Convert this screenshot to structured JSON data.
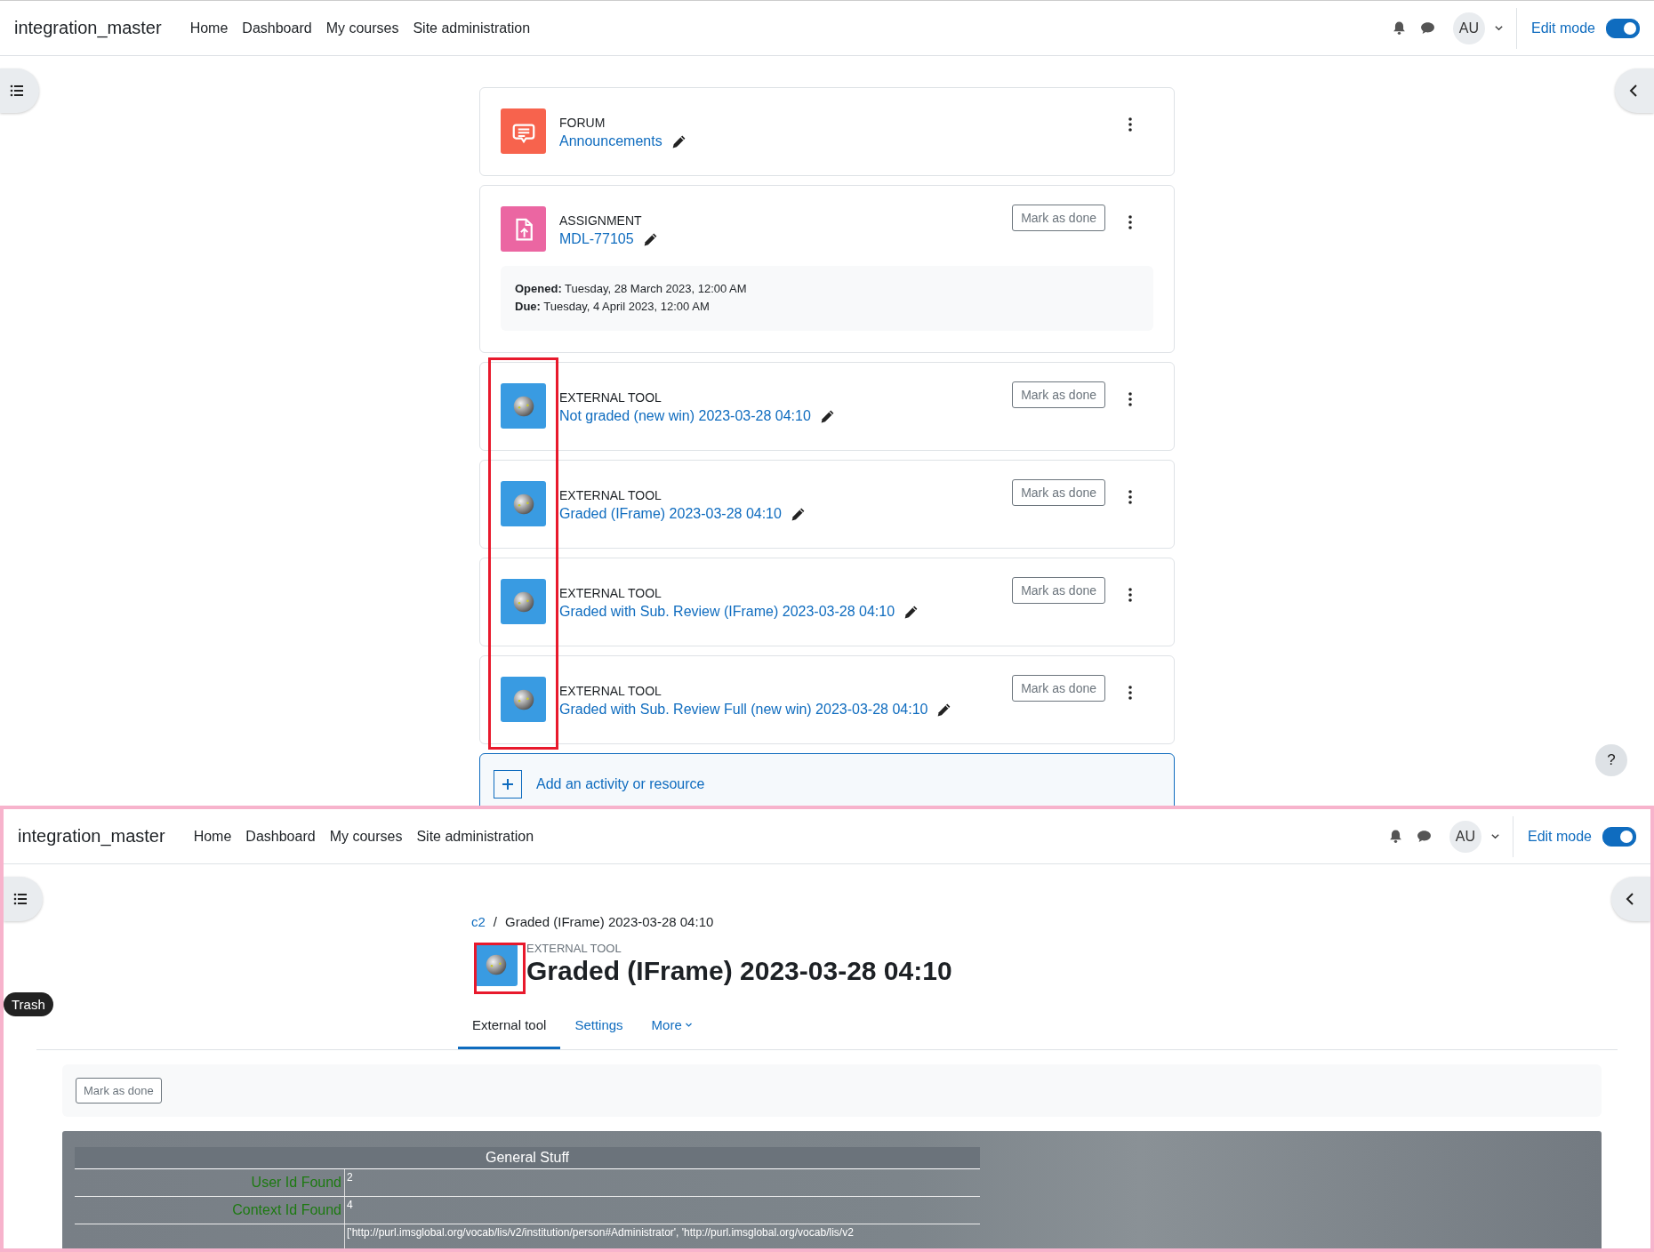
{
  "course_view": {
    "navbar": {
      "site_name": "integration_master",
      "links": [
        "Home",
        "Dashboard",
        "My courses",
        "Site administration"
      ],
      "user_initials": "AU",
      "edit_mode": {
        "label": "Edit mode",
        "on": true
      }
    },
    "activities": [
      {
        "kind": "forum",
        "type_label": "FORUM",
        "name": "Announcements",
        "highlighted": false
      },
      {
        "kind": "assignment",
        "type_label": "ASSIGNMENT",
        "name": "MDL-77105",
        "completion_button": "Mark as done",
        "dates": [
          "**Opened:** Tuesday, 28 March 2023, 12:00 AM",
          "**Due:** Tuesday, 4 April 2023, 12:00 AM"
        ],
        "highlighted": false
      },
      {
        "kind": "external_tool",
        "type_label": "EXTERNAL TOOL",
        "name": "Not graded (new win) 2023-03-28 04:10",
        "completion_button": "Mark as done",
        "highlighted": true
      },
      {
        "kind": "external_tool",
        "type_label": "EXTERNAL TOOL",
        "name": "Graded (IFrame) 2023-03-28 04:10",
        "completion_button": "Mark as done",
        "highlighted": true
      },
      {
        "kind": "external_tool",
        "type_label": "EXTERNAL TOOL",
        "name": "Graded with Sub. Review (IFrame) 2023-03-28 04:10",
        "completion_button": "Mark as done",
        "highlighted": true
      },
      {
        "kind": "external_tool",
        "type_label": "EXTERNAL TOOL",
        "name": "Graded with Sub. Review Full (new win) 2023-03-28 04:10",
        "completion_button": "Mark as done",
        "highlighted": true
      }
    ],
    "add_activity": "Add an activity or resource",
    "help_button": "?"
  },
  "activity_page": {
    "navbar": {
      "site_name": "integration_master",
      "links": [
        "Home",
        "Dashboard",
        "My courses",
        "Site administration"
      ],
      "user_initials": "AU",
      "edit_mode": {
        "label": "Edit mode",
        "on": true
      }
    },
    "breadcrumb": [
      {
        "label": "c2",
        "link": true
      },
      {
        "label": "Graded (IFrame) 2023-03-28 04:10",
        "link": false
      }
    ],
    "breadcrumb_separator": "/",
    "activity_type": "EXTERNAL TOOL",
    "title": "Graded (IFrame) 2023-03-28 04:10",
    "icon_highlighted": true,
    "tooltip": "Trash",
    "tabs": [
      {
        "label": "External tool",
        "selected": true
      },
      {
        "label": "Settings",
        "selected": false
      },
      {
        "label": "More",
        "selected": false,
        "dropdown": true
      }
    ],
    "completion_button": "Mark as done",
    "tool_output": {
      "title": "General Stuff",
      "rows": [
        {
          "label": "User Id Found",
          "value": "2"
        },
        {
          "label": "Context Id Found",
          "value": "4"
        },
        {
          "value": "['http://purl.imsglobal.org/vocab/lis/v2/institution/person#Administrator', 'http://purl.imsglobal.org/vocab/lis/v2"
        }
      ]
    }
  }
}
